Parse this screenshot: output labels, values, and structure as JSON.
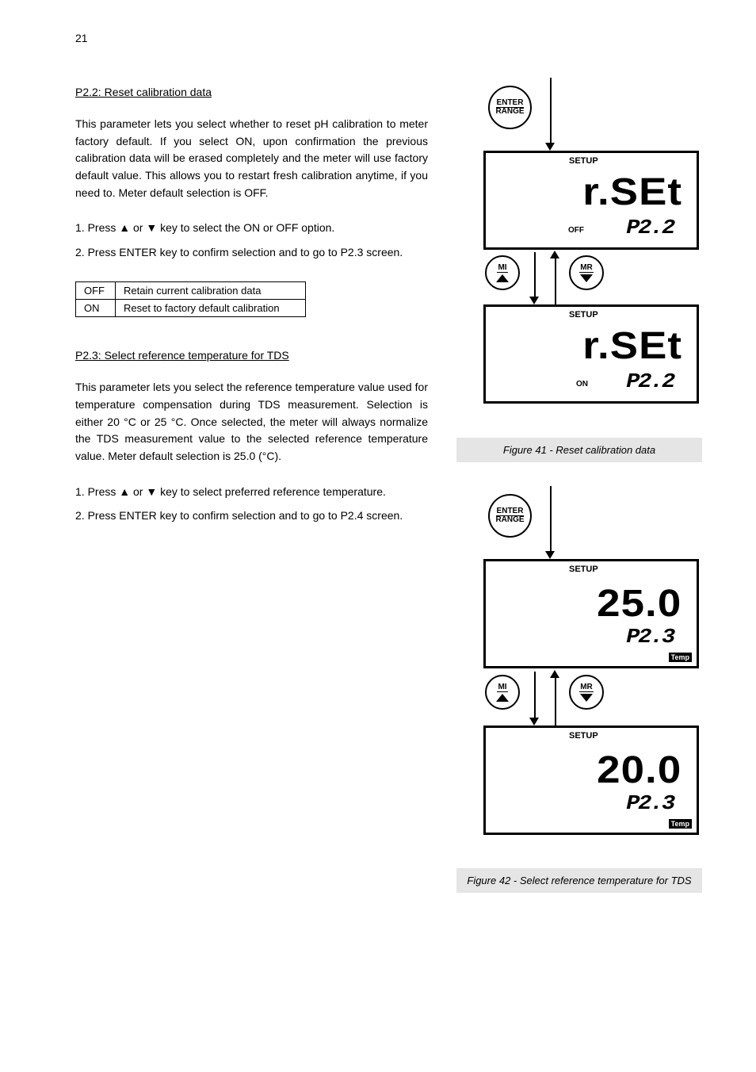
{
  "page_number": "21",
  "section22": {
    "heading": "P2.2: Reset calibration data",
    "para": "This parameter lets you select whether to reset pH calibration to meter factory default.  If you select ON, upon confirmation the previous calibration data will be erased completely and the meter will use factory default value.  This allows you to restart fresh calibration anytime, if you need to.  Meter default selection is OFF.",
    "step1_pre": "1.  Press ",
    "step1_mid": " or ",
    "step1_post": " key to select the ON or OFF option.",
    "step2": "2.  Press ENTER key to confirm selection and to go to P2.3 screen.",
    "table_r1c1": "OFF",
    "table_r1c2": "Retain current calibration data",
    "table_r2c1": "ON",
    "table_r2c2": "Reset to factory default calibration"
  },
  "section23": {
    "heading": "P2.3: Select reference temperature for TDS",
    "para": "This parameter lets you select the reference temperature value used for temperature compensation during TDS measurement.  Selection is either 20 °C or 25 °C.  Once selected, the meter will always normalize the TDS measurement value to the selected reference temperature value.  Meter default selection is 25.0 (°C).",
    "step1_pre": "1.  Press ",
    "step1_mid": " or ",
    "step1_post": " key to select preferred reference temperature.",
    "step2": "2.  Press ENTER key to confirm selection and to go to P2.4 screen."
  },
  "btn": {
    "enter": "ENTER",
    "range": "RANGE",
    "mi": "MI",
    "mr": "MR"
  },
  "lcd": {
    "setup": "SETUP",
    "rset": "r.SEt",
    "p22": "P2.2",
    "off": "OFF",
    "on": "ON",
    "v250": "25.0",
    "v200": "20.0",
    "p23": "P2.3",
    "temp": "Temp"
  },
  "fig41": "Figure 41 - Reset calibration data",
  "fig42": "Figure 42 - Select reference temperature for TDS"
}
